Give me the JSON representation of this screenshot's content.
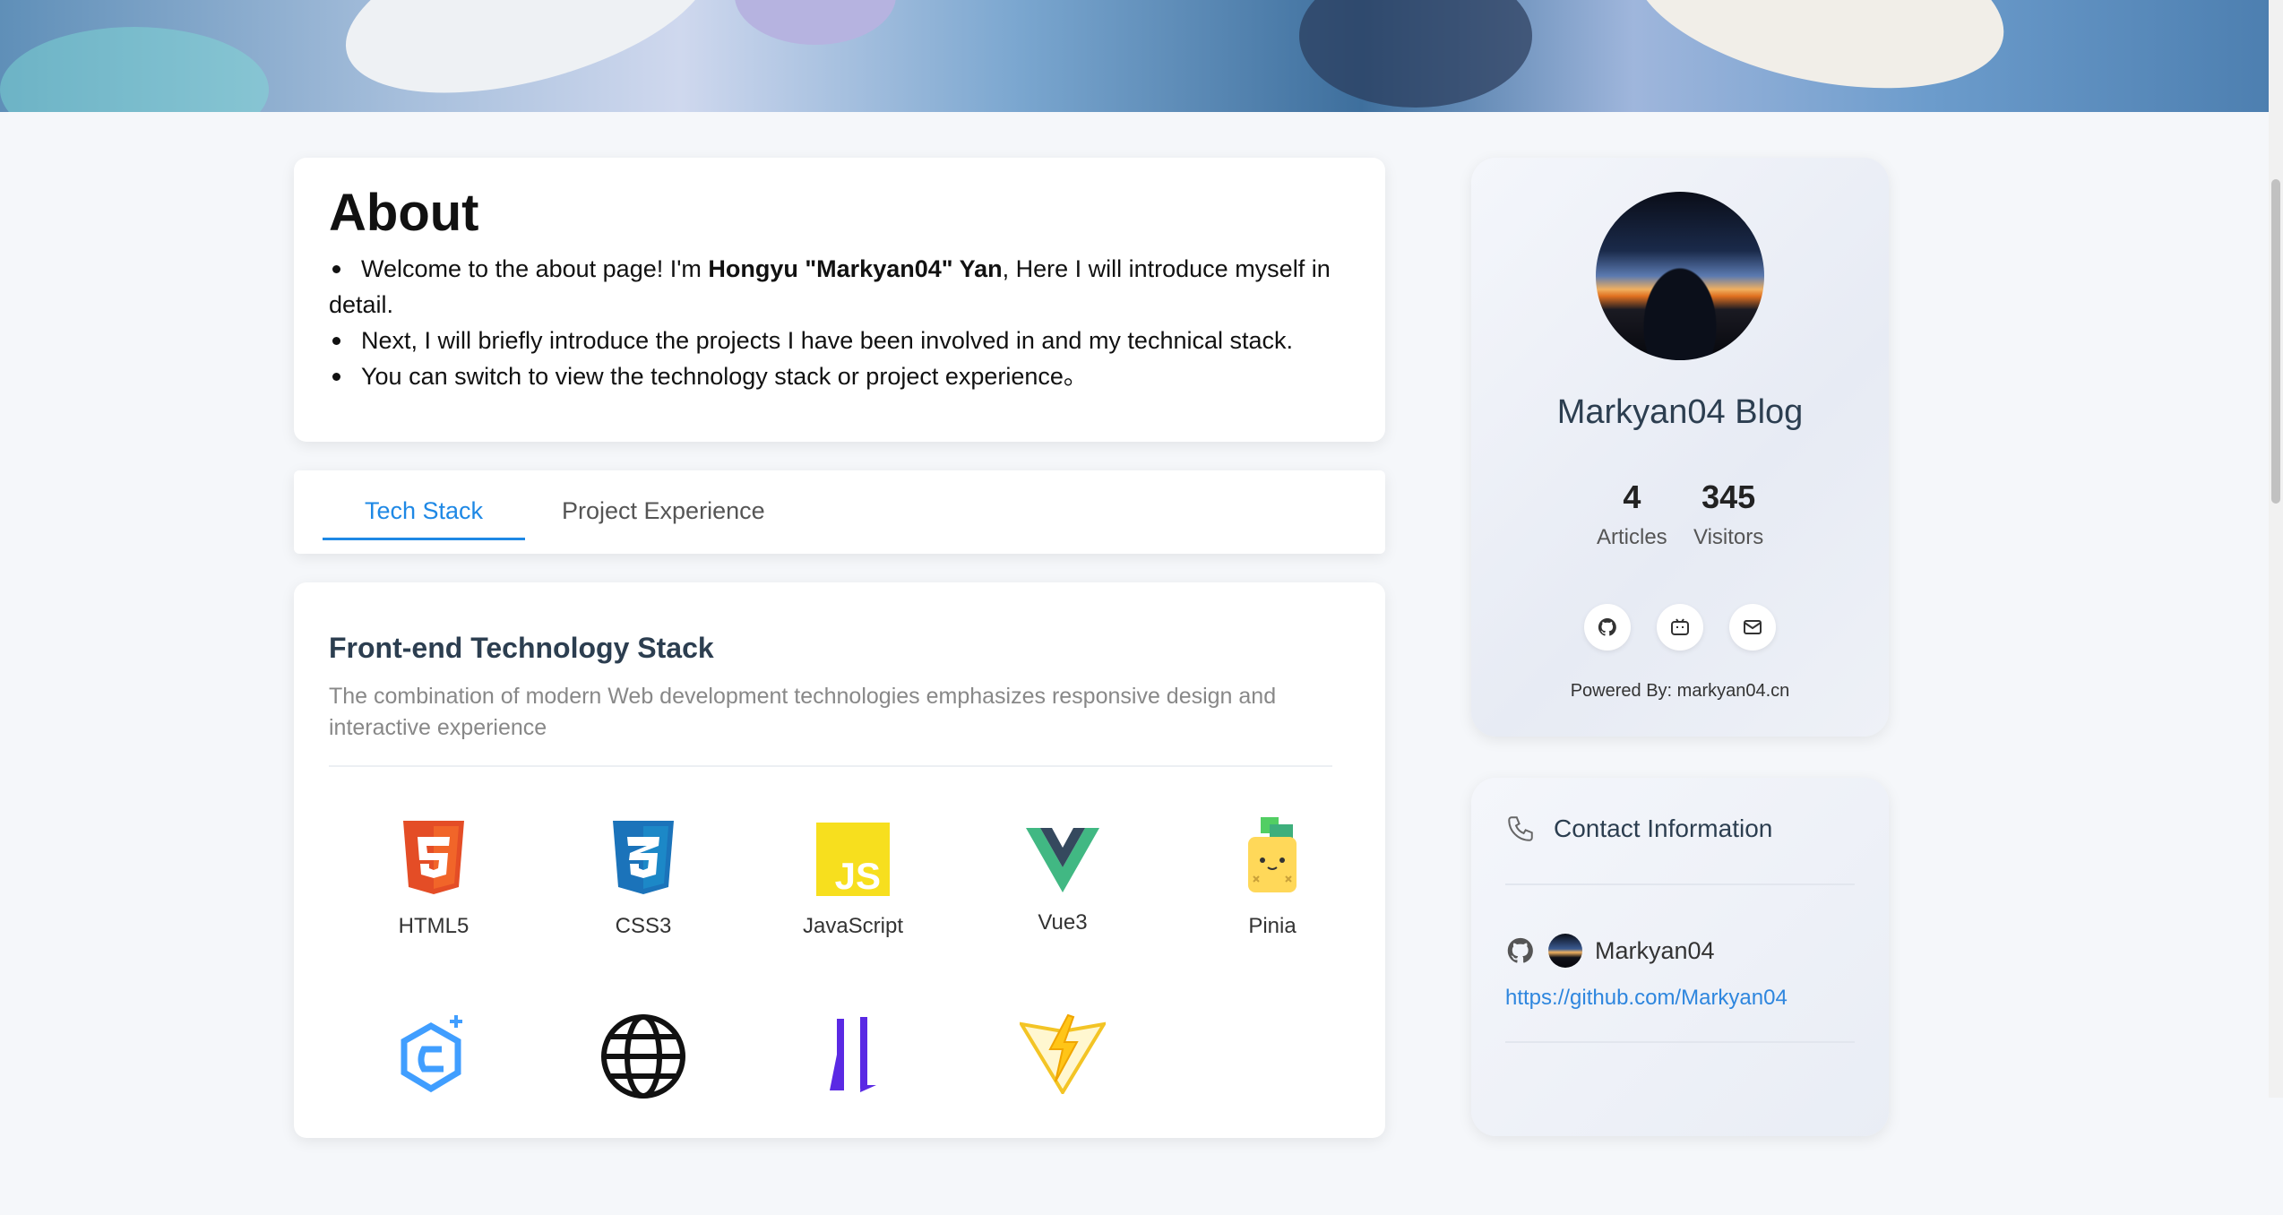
{
  "about": {
    "title": "About",
    "items": [
      {
        "before": "Welcome to the about page! I'm ",
        "bold": "Hongyu \"Markyan04\" Yan",
        "after": ", Here I will introduce myself in",
        "cont": "detail."
      },
      {
        "text": "Next, I will briefly introduce the projects I have been involved in and my technical stack."
      },
      {
        "text": "You can switch to view the technology stack or project experience。"
      }
    ]
  },
  "tabs": [
    {
      "label": "Tech Stack",
      "active": true
    },
    {
      "label": "Project Experience",
      "active": false
    }
  ],
  "tech": {
    "title": "Front-end Technology Stack",
    "description": "The combination of modern Web development technologies emphasizes responsive design and interactive experience",
    "items": [
      {
        "label": "HTML5",
        "icon": "html5-icon"
      },
      {
        "label": "CSS3",
        "icon": "css3-icon"
      },
      {
        "label": "JavaScript",
        "icon": "javascript-icon"
      },
      {
        "label": "Vue3",
        "icon": "vue-icon"
      },
      {
        "label": "Pinia",
        "icon": "pinia-icon"
      },
      {
        "icon": "element-plus-icon"
      },
      {
        "icon": "globe-icon"
      },
      {
        "icon": "axios-icon"
      },
      {
        "icon": "vite-icon"
      }
    ]
  },
  "profile": {
    "blog_name": "Markyan04 Blog",
    "articles_count": "4",
    "articles_label": "Articles",
    "visitors_count": "345",
    "visitors_label": "Visitors",
    "social": [
      "github-icon",
      "bilibili-icon",
      "mail-icon"
    ],
    "powered": "Powered By: markyan04.cn"
  },
  "contact": {
    "title": "Contact Information",
    "github_name": "Markyan04",
    "github_url": "https://github.com/Markyan04"
  },
  "colors": {
    "accent": "#1e88e5",
    "link": "#2e86de",
    "html5": "#e44d26",
    "css3": "#1b73ba",
    "js": "#f7df1e",
    "vue_green": "#41b883",
    "vue_dark": "#35495e"
  }
}
